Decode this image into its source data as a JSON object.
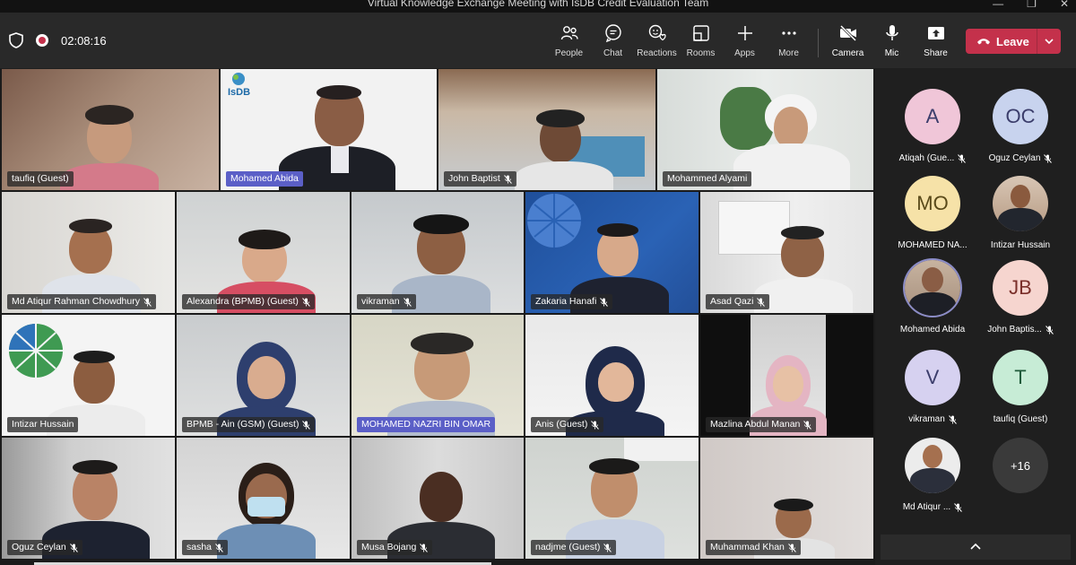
{
  "window": {
    "title": "Virtual Knowledge Exchange Meeting with IsDB Credit Evaluation Team",
    "controls": [
      "—",
      "❐",
      "✕"
    ]
  },
  "toolbar": {
    "timer": "02:08:16",
    "buttons": [
      {
        "label": "People",
        "icon": "people-icon"
      },
      {
        "label": "Chat",
        "icon": "chat-icon"
      },
      {
        "label": "Reactions",
        "icon": "reactions-icon"
      },
      {
        "label": "Rooms",
        "icon": "rooms-icon"
      },
      {
        "label": "Apps",
        "icon": "plus-icon"
      },
      {
        "label": "More",
        "icon": "more-icon"
      }
    ],
    "devices": [
      {
        "label": "Camera",
        "icon": "camera-off-icon"
      },
      {
        "label": "Mic",
        "icon": "mic-icon"
      },
      {
        "label": "Share",
        "icon": "share-icon"
      }
    ],
    "leave_label": "Leave",
    "leave_color": "#c4314b"
  },
  "grid": {
    "tiles": [
      {
        "name": "taufiq (Guest)",
        "highlight": false
      },
      {
        "name": "Mohamed Abida",
        "highlight": true
      },
      {
        "name": "John Baptist",
        "highlight": false
      },
      {
        "name": "Mohammed Alyami",
        "highlight": false
      },
      {
        "name": "Md Atiqur Rahman Chowdhury",
        "highlight": false
      },
      {
        "name": "Alexandra (BPMB) (Guest)",
        "highlight": false
      },
      {
        "name": "vikraman",
        "highlight": false
      },
      {
        "name": "Zakaria Hanafi",
        "highlight": false
      },
      {
        "name": "Asad Qazi",
        "highlight": false
      },
      {
        "name": "Intizar Hussain",
        "highlight": false
      },
      {
        "name": "BPMB - Ain (GSM) (Guest)",
        "highlight": false
      },
      {
        "name": "MOHAMED NAZRI BIN OMAR",
        "highlight": true
      },
      {
        "name": "Anis (Guest)",
        "highlight": false
      },
      {
        "name": "Mazlina Abdul Manan",
        "highlight": false
      },
      {
        "name": "Oguz Ceylan",
        "highlight": false
      },
      {
        "name": "sasha",
        "highlight": false
      },
      {
        "name": "Musa Bojang",
        "highlight": false
      },
      {
        "name": "nadjme (Guest)",
        "highlight": false
      },
      {
        "name": "Muhammad Khan",
        "highlight": false
      }
    ],
    "logo_text": "IsDB"
  },
  "sidebar": {
    "participants": [
      {
        "initials": "A",
        "name": "Atiqah (Gue...",
        "color": "#f0c6d8"
      },
      {
        "initials": "OC",
        "name": "Oguz Ceylan",
        "color": "#c8d3ee"
      },
      {
        "initials": "MO",
        "name": "MOHAMED NA...",
        "color": "#f6e2a8"
      },
      {
        "initials": "",
        "name": "Intizar Hussain",
        "color": "#9a6a4c"
      },
      {
        "initials": "",
        "name": "Mohamed Abida",
        "color": "#9a6a4c"
      },
      {
        "initials": "JB",
        "name": "John Baptis...",
        "color": "#f6d5cf"
      },
      {
        "initials": "V",
        "name": "vikraman",
        "color": "#d6d1f0"
      },
      {
        "initials": "T",
        "name": "taufiq (Guest)",
        "color": "#c7ecd6"
      },
      {
        "initials": "",
        "name": "Md Atiqur ...",
        "color": "#e8e8e8"
      }
    ],
    "more_count": "+16"
  }
}
